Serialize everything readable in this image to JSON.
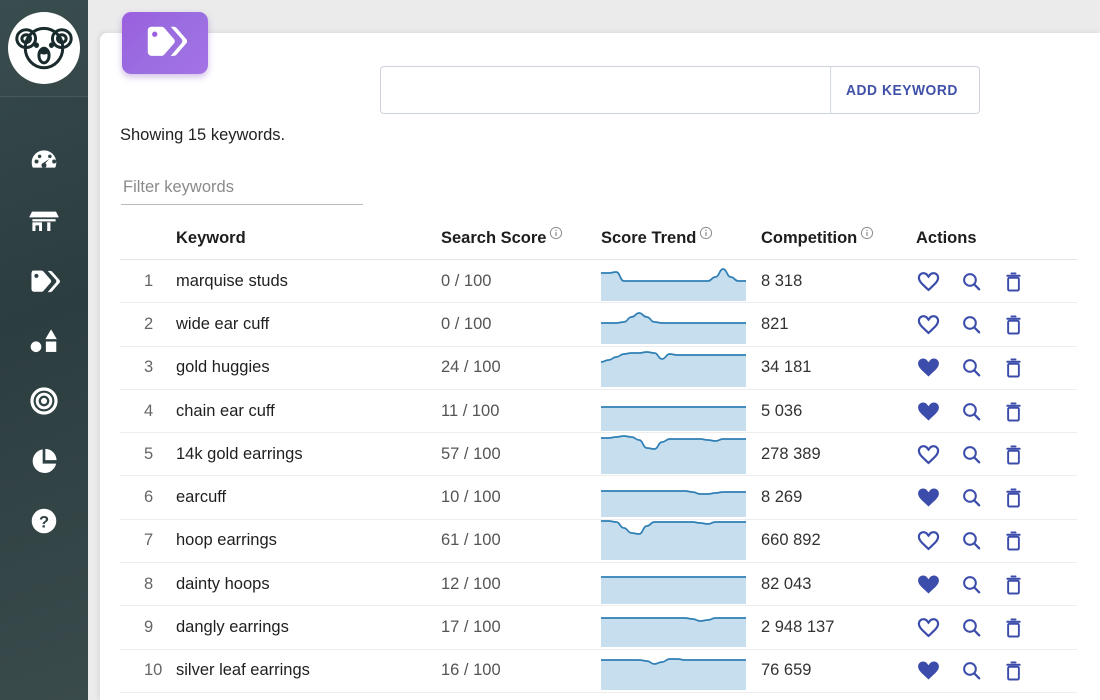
{
  "brand": {
    "logo_icon": "koala-logo"
  },
  "sidebar": {
    "items": [
      {
        "icon": "dashboard-gauge-icon",
        "name": "dashboard"
      },
      {
        "icon": "shop-storefront-icon",
        "name": "shop"
      },
      {
        "icon": "tags-icon",
        "name": "keywords"
      },
      {
        "icon": "shapes-icon",
        "name": "listings"
      },
      {
        "icon": "target-icon",
        "name": "target"
      },
      {
        "icon": "pie-chart-icon",
        "name": "stats"
      },
      {
        "icon": "help-question-icon",
        "name": "help"
      }
    ]
  },
  "header": {
    "badge_icon": "tags-icon",
    "add_keyword": {
      "input_value": "",
      "placeholder": "",
      "button_label": "ADD KEYWORD"
    }
  },
  "toolbar": {
    "showing_text": "Showing 15 keywords.",
    "filter": {
      "value": "",
      "placeholder": "Filter keywords"
    }
  },
  "table": {
    "columns": [
      {
        "key": "num",
        "label": "",
        "info": false
      },
      {
        "key": "kw",
        "label": "Keyword",
        "info": false
      },
      {
        "key": "score",
        "label": "Search Score",
        "info": true
      },
      {
        "key": "trend",
        "label": "Score Trend",
        "info": true
      },
      {
        "key": "comp",
        "label": "Competition",
        "info": true
      },
      {
        "key": "act",
        "label": "Actions",
        "info": false
      }
    ],
    "actions": {
      "favorite_icon": "heart-icon",
      "search_icon": "magnifier-icon",
      "delete_icon": "trash-icon"
    },
    "rows": [
      {
        "num": "1",
        "keyword": "marquise studs",
        "score": "0 / 100",
        "competition": "8 318",
        "favorite": false,
        "trend": [
          18,
          18,
          17,
          26,
          26,
          26,
          26,
          26,
          26,
          26,
          26,
          26,
          26,
          26,
          26,
          22,
          14,
          22,
          26,
          26
        ]
      },
      {
        "num": "2",
        "keyword": "wide ear cuff",
        "score": "0 / 100",
        "competition": "821",
        "favorite": false,
        "trend": [
          25,
          25,
          25,
          24,
          19,
          15,
          19,
          24,
          25,
          25,
          25,
          25,
          25,
          25,
          25,
          25,
          25,
          25,
          25,
          25
        ]
      },
      {
        "num": "3",
        "keyword": "gold huggies",
        "score": "24 / 100",
        "competition": "34 181",
        "favorite": true,
        "trend": [
          21,
          19,
          16,
          13,
          12,
          12,
          11,
          12,
          18,
          13,
          14,
          14,
          14,
          14,
          14,
          14,
          14,
          14,
          14,
          14
        ]
      },
      {
        "num": "4",
        "keyword": "chain ear cuff",
        "score": "11 / 100",
        "competition": "5 036",
        "favorite": true,
        "trend": [
          22,
          22,
          22,
          22,
          22,
          22,
          22,
          22,
          22,
          22,
          22,
          22,
          22,
          22,
          22,
          22,
          22,
          22,
          22,
          22
        ]
      },
      {
        "num": "5",
        "keyword": "14k gold earrings",
        "score": "57 / 100",
        "competition": "278 389",
        "favorite": false,
        "trend": [
          10,
          10,
          9,
          8,
          9,
          12,
          20,
          21,
          14,
          11,
          11,
          11,
          11,
          11,
          12,
          13,
          11,
          11,
          11,
          11
        ]
      },
      {
        "num": "6",
        "keyword": "earcuff",
        "score": "10 / 100",
        "competition": "8 269",
        "favorite": true,
        "trend": [
          20,
          20,
          20,
          20,
          20,
          20,
          20,
          20,
          20,
          20,
          20,
          20,
          21,
          23,
          23,
          22,
          21,
          21,
          21,
          21
        ]
      },
      {
        "num": "7",
        "keyword": "hoop earrings",
        "score": "61 / 100",
        "competition": "660 892",
        "favorite": false,
        "trend": [
          7,
          7,
          8,
          14,
          19,
          20,
          12,
          8,
          8,
          8,
          8,
          8,
          8,
          9,
          10,
          8,
          8,
          8,
          8,
          8
        ]
      },
      {
        "num": "8",
        "keyword": "dainty hoops",
        "score": "12 / 100",
        "competition": "82 043",
        "favorite": true,
        "trend": [
          19,
          19,
          19,
          19,
          19,
          19,
          19,
          19,
          19,
          19,
          19,
          19,
          19,
          19,
          19,
          19,
          19,
          19,
          19,
          19
        ]
      },
      {
        "num": "9",
        "keyword": "dangly earrings",
        "score": "17 / 100",
        "competition": "2 948 137",
        "favorite": false,
        "trend": [
          17,
          17,
          17,
          17,
          17,
          17,
          17,
          17,
          17,
          17,
          17,
          17,
          18,
          20,
          19,
          17,
          17,
          17,
          17,
          17
        ]
      },
      {
        "num": "10",
        "keyword": "silver leaf earrings",
        "score": "16 / 100",
        "competition": "76 659",
        "favorite": true,
        "trend": [
          16,
          16,
          16,
          16,
          16,
          16,
          17,
          20,
          18,
          15,
          15,
          16,
          16,
          16,
          16,
          16,
          16,
          16,
          16,
          16
        ]
      }
    ]
  },
  "colors": {
    "sidebar": "#2f4144",
    "badge_purple": "#9b5ede",
    "accent_blue": "#3b4cab",
    "spark_line": "#2f7fb5",
    "spark_fill": "#c3dcec",
    "page_bg": "#ebebeb"
  }
}
